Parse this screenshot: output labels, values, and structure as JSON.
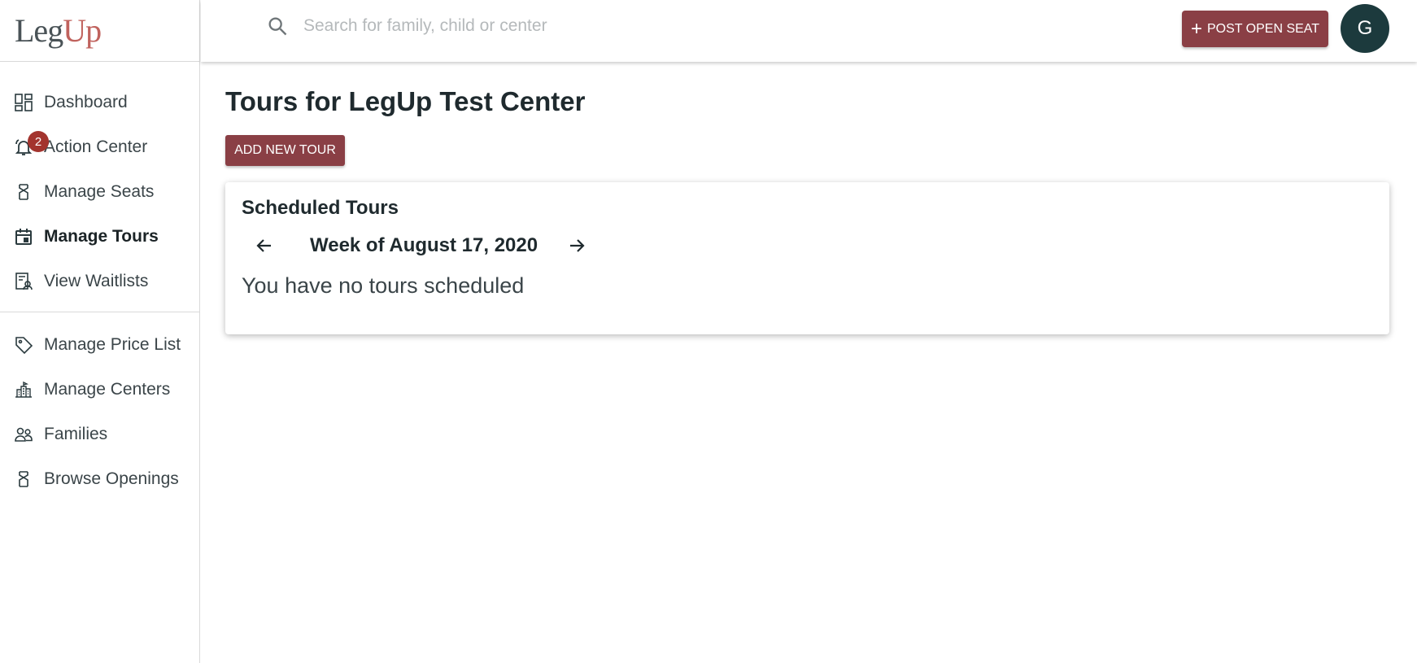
{
  "logo": {
    "part1": "Leg",
    "part2": "Up"
  },
  "sidebar": {
    "items": [
      {
        "label": "Dashboard",
        "icon": "dashboard-icon"
      },
      {
        "label": "Action Center",
        "icon": "bell-icon",
        "badge": "2"
      },
      {
        "label": "Manage Seats",
        "icon": "seat-icon"
      },
      {
        "label": "Manage Tours",
        "icon": "calendar-icon",
        "active": true
      },
      {
        "label": "View Waitlists",
        "icon": "waitlist-icon"
      },
      {
        "label": "Manage Price List",
        "icon": "tag-icon"
      },
      {
        "label": "Manage Centers",
        "icon": "building-icon"
      },
      {
        "label": "Families",
        "icon": "people-icon"
      },
      {
        "label": "Browse Openings",
        "icon": "seat-icon"
      }
    ]
  },
  "header": {
    "search_placeholder": "Search for family, child or center",
    "post_label": "POST OPEN SEAT",
    "avatar_initial": "G"
  },
  "main": {
    "title": "Tours for LegUp Test Center",
    "add_tour_label": "ADD NEW TOUR",
    "card": {
      "title": "Scheduled Tours",
      "week_label": "Week of August 17, 2020",
      "empty_message": "You have no tours scheduled"
    }
  },
  "colors": {
    "brand_button": "#8a3f45",
    "badge": "#a3342e",
    "avatar": "#1c3a3d"
  }
}
